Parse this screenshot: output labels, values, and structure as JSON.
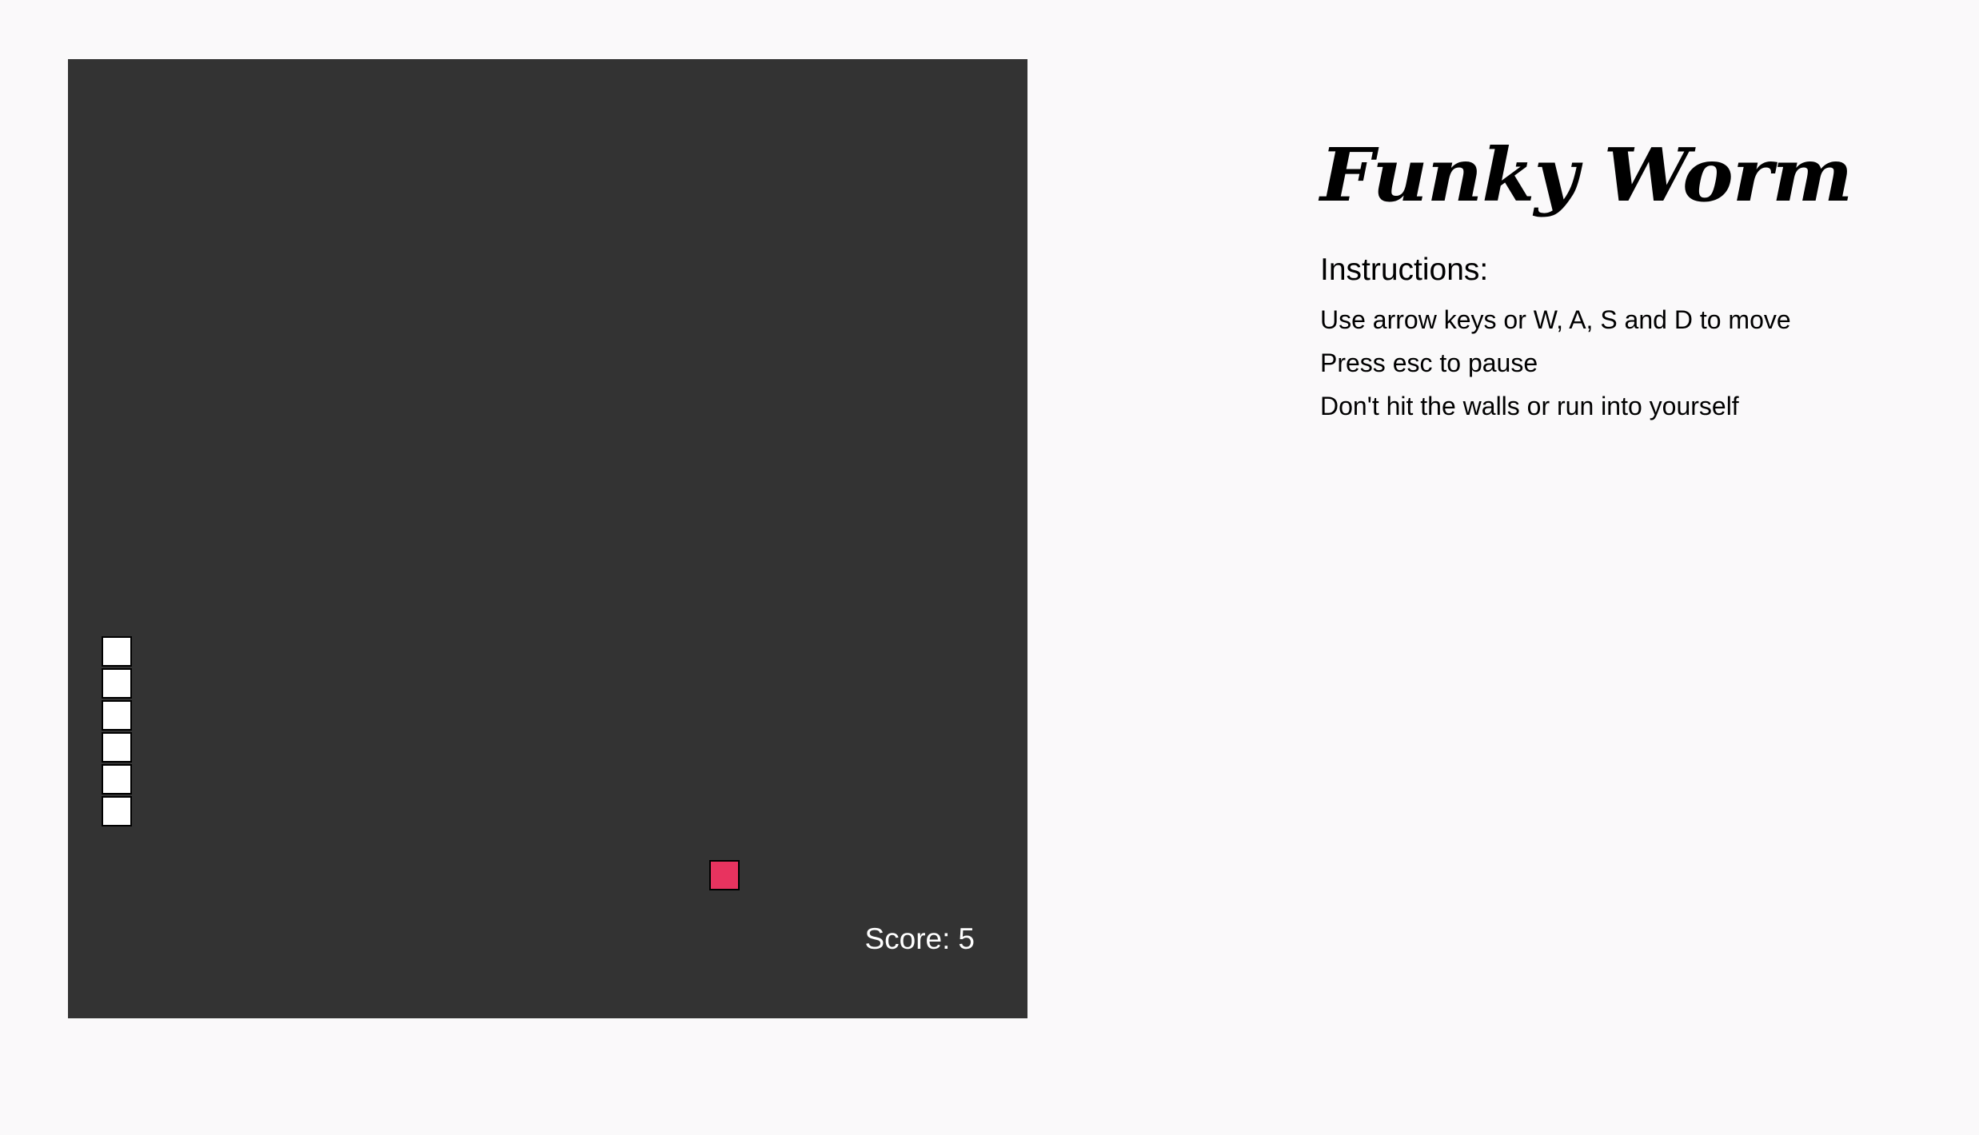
{
  "game": {
    "grid_columns": 30,
    "grid_rows": 30,
    "worm": [
      {
        "col": 1,
        "row": 18
      },
      {
        "col": 1,
        "row": 19
      },
      {
        "col": 1,
        "row": 20
      },
      {
        "col": 1,
        "row": 21
      },
      {
        "col": 1,
        "row": 22
      },
      {
        "col": 1,
        "row": 23
      }
    ],
    "food": {
      "col": 20,
      "row": 25
    },
    "score_label": "Score:",
    "score_value": "5",
    "colors": {
      "board": "#333333",
      "worm": "#ffffff",
      "food": "#e8335f",
      "score_text": "#ffffff",
      "page_background": "#faf9fa"
    }
  },
  "sidebar": {
    "title": "Funky Worm",
    "instructions_heading": "Instructions:",
    "instructions": [
      "Use arrow keys or W, A, S and D to move",
      "Press esc to pause",
      "Don't hit the walls or run into yourself"
    ]
  }
}
